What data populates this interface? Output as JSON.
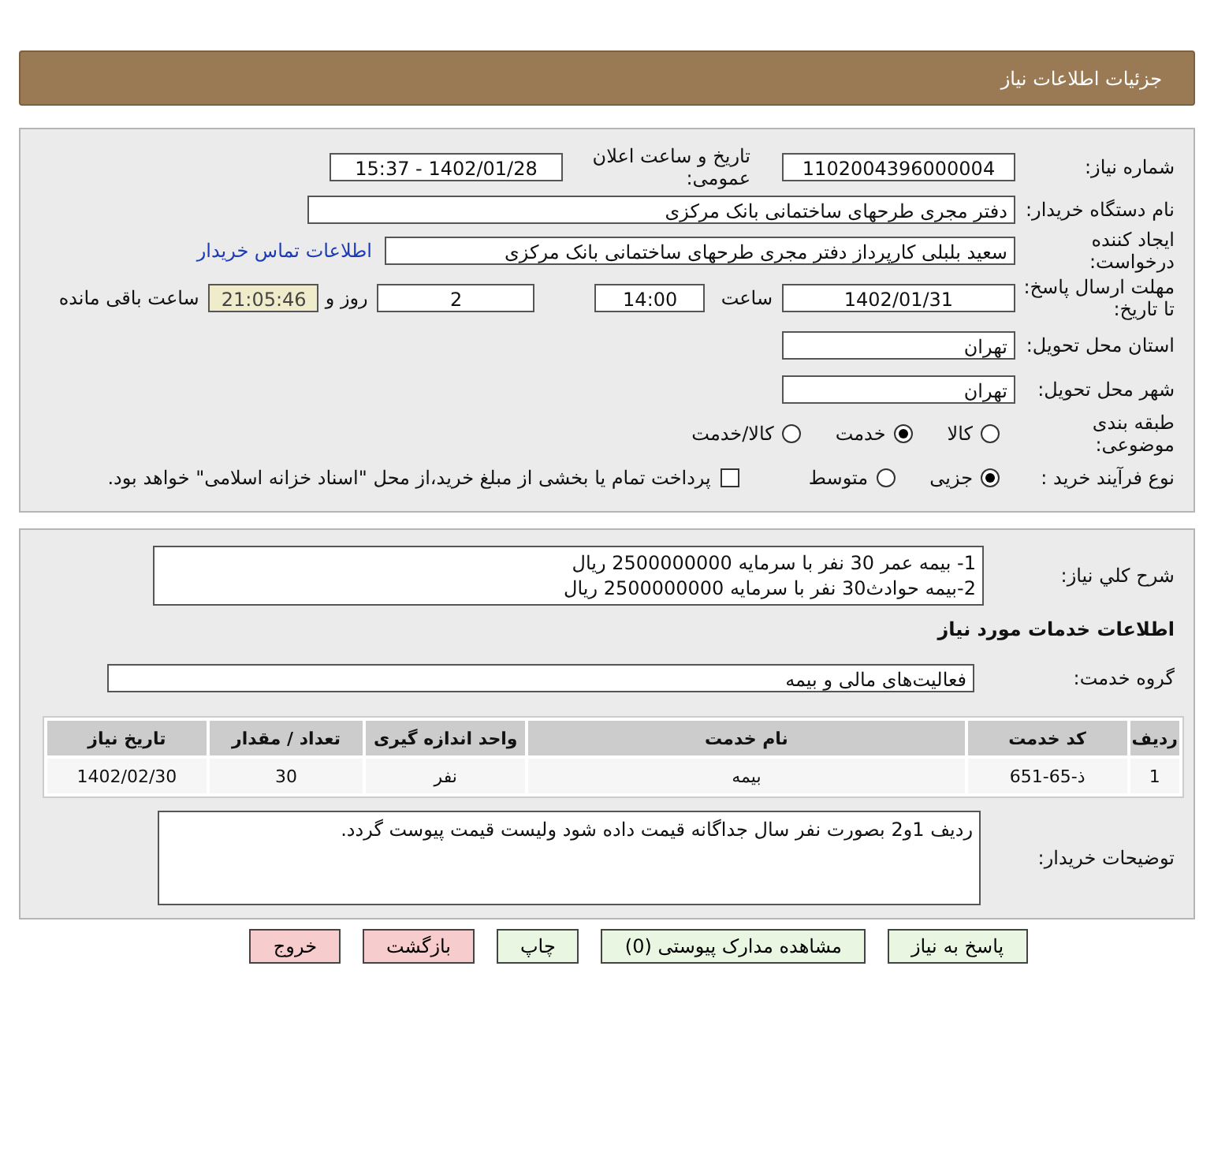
{
  "header": {
    "title": "جزئیات اطلاعات نیاز"
  },
  "need_number": {
    "label": "شماره نیاز:",
    "value": "1102004396000004"
  },
  "announce_date": {
    "label": "تاریخ و ساعت اعلان عمومی:",
    "value": "1402/01/28 - 15:37"
  },
  "buyer_org": {
    "label": "نام دستگاه خریدار:",
    "value": "دفتر مجری طرحهای ساختمانی بانک مرکزی"
  },
  "requester": {
    "label": "ایجاد کننده درخواست:",
    "value": "سعید بلبلی کارپرداز دفتر مجری طرحهای ساختمانی بانک مرکزی",
    "link": "اطلاعات تماس خریدار"
  },
  "deadline": {
    "label": "مهلت ارسال پاسخ: تا تاریخ:",
    "date": "1402/01/31",
    "time_label": "ساعت",
    "time": "14:00",
    "days": "2",
    "days_label": "روز و",
    "remaining": "21:05:46",
    "remaining_label": "ساعت باقی مانده"
  },
  "province": {
    "label": "استان محل تحویل:",
    "value": "تهران"
  },
  "city": {
    "label": "شهر محل تحویل:",
    "value": "تهران"
  },
  "category": {
    "label": "طبقه بندی موضوعی:",
    "options": [
      {
        "label": "کالا",
        "selected": false
      },
      {
        "label": "خدمت",
        "selected": true
      },
      {
        "label": "کالا/خدمت",
        "selected": false
      }
    ]
  },
  "process": {
    "label": "نوع فرآیند خرید :",
    "options": [
      {
        "label": "جزیی",
        "selected": true
      },
      {
        "label": "متوسط",
        "selected": false
      }
    ],
    "payment": {
      "checked": false,
      "label": "پرداخت تمام یا بخشی از مبلغ خرید،از محل \"اسناد خزانه اسلامی\" خواهد بود."
    }
  },
  "description": {
    "label": "شرح کلي نیاز:",
    "lines": [
      "1- بیمه عمر 30 نفر با سرمایه 2500000000 ریال",
      "2-بیمه حوادث30 نفر با سرمایه 2500000000 ریال"
    ]
  },
  "services_heading": "اطلاعات خدمات مورد نیاز",
  "service_group": {
    "label": "گروه خدمت:",
    "value": "فعالیت‌های مالی و بیمه"
  },
  "table": {
    "columns": [
      "ردیف",
      "کد خدمت",
      "نام خدمت",
      "واحد اندازه گیری",
      "تعداد / مقدار",
      "تاریخ نیاز"
    ],
    "rows": [
      [
        "1",
        "ذ-65-651",
        "بیمه",
        "نفر",
        "30",
        "1402/02/30"
      ]
    ]
  },
  "buyer_notes": {
    "label": "توضیحات خریدار:",
    "value": "ردیف 1و2 بصورت نفر سال جداگانه قیمت داده شود ولیست قیمت پیوست گردد."
  },
  "buttons": [
    {
      "label": "پاسخ به نیاز",
      "kind": "normal"
    },
    {
      "label": "مشاهده مدارک پیوستی (0)",
      "kind": "normal"
    },
    {
      "label": "چاپ",
      "kind": "normal"
    },
    {
      "label": "بازگشت",
      "kind": "danger"
    },
    {
      "label": "خروج",
      "kind": "danger"
    }
  ]
}
